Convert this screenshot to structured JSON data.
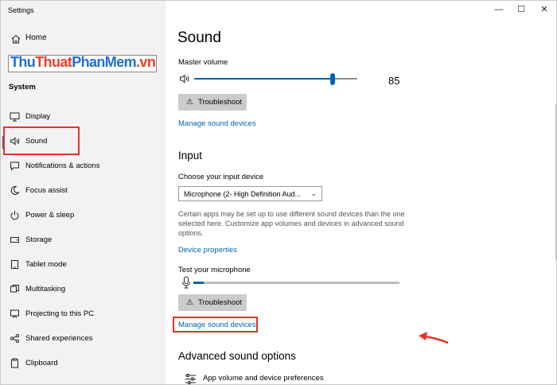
{
  "app": {
    "title": "Settings"
  },
  "window_controls": {
    "minimize": "—",
    "maximize": "☐",
    "close": "✕"
  },
  "sidebar": {
    "home_label": "Home",
    "search_placeholder": "",
    "watermark": {
      "part1": "Thu",
      "part2": "Thuat",
      "part3": "PhanMem",
      "part4": ".vn"
    },
    "section": "System",
    "items": [
      {
        "label": "Display",
        "icon": "monitor-icon"
      },
      {
        "label": "Sound",
        "icon": "speaker-icon",
        "selected": true
      },
      {
        "label": "Notifications & actions",
        "icon": "notification-icon"
      },
      {
        "label": "Focus assist",
        "icon": "moon-icon"
      },
      {
        "label": "Power & sleep",
        "icon": "power-icon"
      },
      {
        "label": "Storage",
        "icon": "storage-icon"
      },
      {
        "label": "Tablet mode",
        "icon": "tablet-icon"
      },
      {
        "label": "Multitasking",
        "icon": "multitasking-icon"
      },
      {
        "label": "Projecting to this PC",
        "icon": "projector-icon"
      },
      {
        "label": "Shared experiences",
        "icon": "share-icon"
      },
      {
        "label": "Clipboard",
        "icon": "clipboard-icon"
      }
    ]
  },
  "main": {
    "title": "Sound",
    "master_volume_label": "Master volume",
    "master_volume_value": "85",
    "master_volume_level": 0.85,
    "troubleshoot_label": "Troubleshoot",
    "manage_devices_label": "Manage sound devices",
    "input_heading": "Input",
    "input_device_label": "Choose your input device",
    "input_device_value": "Microphone (2- High Definition Aud...",
    "description": "Certain apps may be set up to use different sound devices than the one selected here. Customize app volumes and devices in advanced sound options.",
    "device_properties_label": "Device properties",
    "test_mic_label": "Test your microphone",
    "mic_level": 0.05,
    "troubleshoot2_label": "Troubleshoot",
    "manage_devices2_label": "Manage sound devices",
    "advanced_heading": "Advanced sound options",
    "app_volume_label": "App volume and device preferences"
  },
  "colors": {
    "accent": "#0063b1",
    "highlight_box": "#e8322b",
    "sidebar_bg": "#f2f2f2"
  }
}
